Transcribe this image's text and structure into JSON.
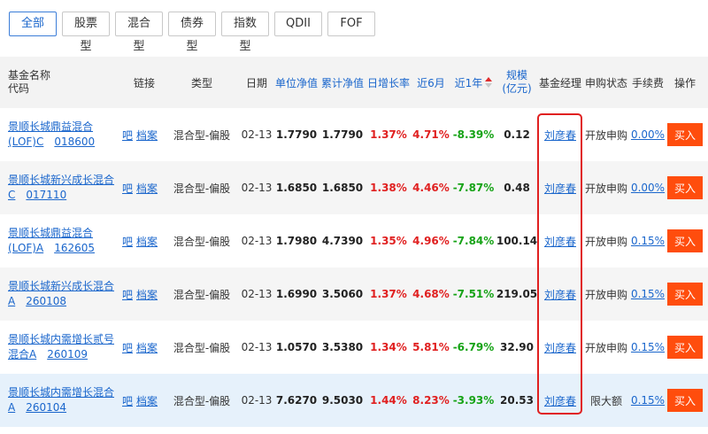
{
  "tabs": [
    {
      "label": "全部",
      "active": true
    },
    {
      "label": "股票型"
    },
    {
      "label": "混合型"
    },
    {
      "label": "债券型"
    },
    {
      "label": "指数型"
    },
    {
      "label": "QDII"
    },
    {
      "label": "FOF"
    }
  ],
  "header": {
    "name": "基金名称",
    "code": "代码",
    "link": "链接",
    "type": "类型",
    "date": "日期",
    "unit_nav": "单位净值",
    "cum_nav": "累计净值",
    "daily": "日增长率",
    "m6": "近6月",
    "y1": "近1年",
    "size_line1": "规模",
    "size_line2": "(亿元)",
    "manager": "基金经理",
    "status": "申购状态",
    "fee": "手续费",
    "op": "操作"
  },
  "link_labels": {
    "bar": "吧",
    "archive": "档案"
  },
  "buy_label": "买入",
  "rows": [
    {
      "name1": "景顺长城鼎益混合",
      "name2": "(LOF)C",
      "code": "018600",
      "type": "混合型-偏股",
      "date": "02-13",
      "unit": "1.7790",
      "cum": "1.7790",
      "daily": "1.37%",
      "m6": "4.71%",
      "y1": "-8.39%",
      "size": "0.12",
      "manager": "刘彦春",
      "status": "开放申购",
      "fee": "0.00%"
    },
    {
      "name1": "景顺长城新兴成长混合",
      "name2": "C",
      "code": "017110",
      "type": "混合型-偏股",
      "date": "02-13",
      "unit": "1.6850",
      "cum": "1.6850",
      "daily": "1.38%",
      "m6": "4.46%",
      "y1": "-7.87%",
      "size": "0.48",
      "manager": "刘彦春",
      "status": "开放申购",
      "fee": "0.00%"
    },
    {
      "name1": "景顺长城鼎益混合",
      "name2": "(LOF)A",
      "code": "162605",
      "type": "混合型-偏股",
      "date": "02-13",
      "unit": "1.7980",
      "cum": "4.7390",
      "daily": "1.35%",
      "m6": "4.96%",
      "y1": "-7.84%",
      "size": "100.14",
      "manager": "刘彦春",
      "status": "开放申购",
      "fee": "0.15%"
    },
    {
      "name1": "景顺长城新兴成长混合",
      "name2": "A",
      "code": "260108",
      "type": "混合型-偏股",
      "date": "02-13",
      "unit": "1.6990",
      "cum": "3.5060",
      "daily": "1.37%",
      "m6": "4.68%",
      "y1": "-7.51%",
      "size": "219.05",
      "manager": "刘彦春",
      "status": "开放申购",
      "fee": "0.15%"
    },
    {
      "name1": "景顺长城内需增长贰号",
      "name2": "混合A",
      "code": "260109",
      "type": "混合型-偏股",
      "date": "02-13",
      "unit": "1.0570",
      "cum": "3.5380",
      "daily": "1.34%",
      "m6": "5.81%",
      "y1": "-6.79%",
      "size": "32.90",
      "manager": "刘彦春",
      "status": "开放申购",
      "fee": "0.15%"
    },
    {
      "name1": "景顺长城内需增长混合",
      "name2": "A",
      "code": "260104",
      "type": "混合型-偏股",
      "date": "02-13",
      "unit": "7.6270",
      "cum": "9.5030",
      "daily": "1.44%",
      "m6": "8.23%",
      "y1": "-3.93%",
      "size": "20.53",
      "manager": "刘彦春",
      "status": "限大额",
      "fee": "0.15%"
    }
  ],
  "colors": {
    "link": "#1a66cc",
    "up": "#e02020",
    "down": "#16a316",
    "buy": "#ff4d0d",
    "highlight": "#e02020"
  }
}
